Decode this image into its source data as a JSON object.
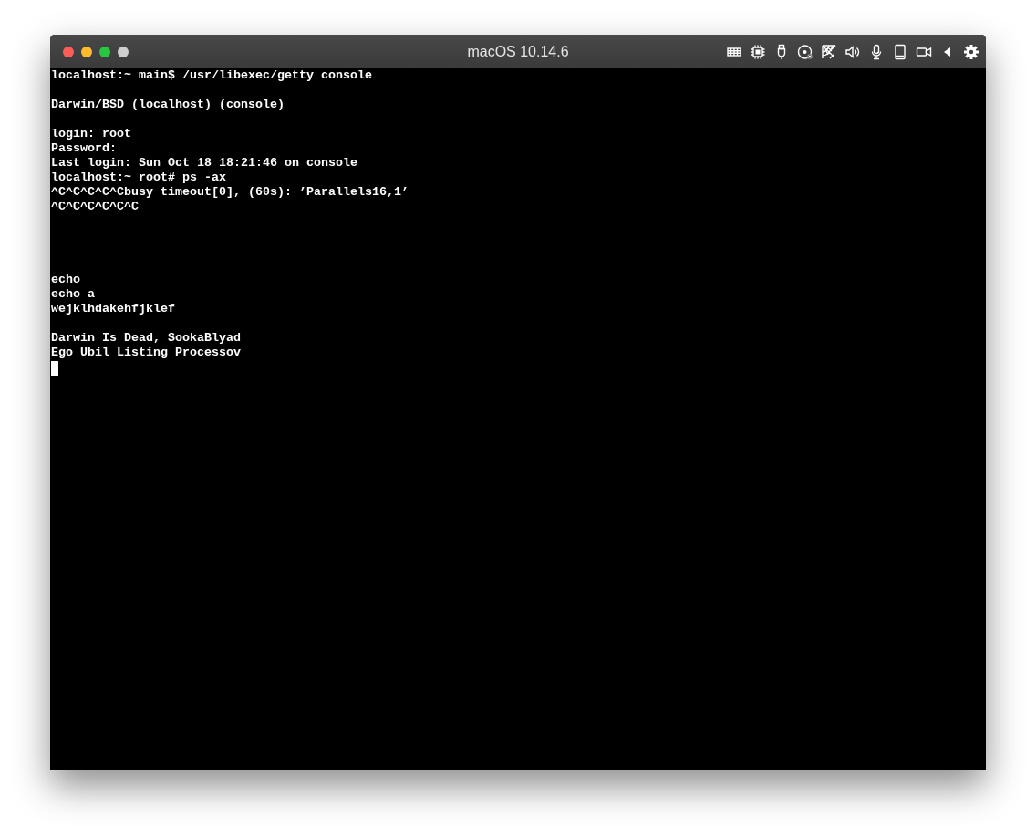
{
  "window": {
    "title": "macOS 10.14.6"
  },
  "terminal": {
    "lines": [
      {
        "kind": "text",
        "text": "localhost:~ main$ /usr/libexec/getty console"
      },
      {
        "kind": "blank"
      },
      {
        "kind": "text",
        "text": "Darwin/BSD (localhost) (console)"
      },
      {
        "kind": "blank"
      },
      {
        "kind": "text",
        "text": "login: root"
      },
      {
        "kind": "text",
        "text": "Password:"
      },
      {
        "kind": "text",
        "text": "Last login: Sun Oct 18 18:21:46 on console"
      },
      {
        "kind": "text",
        "text": "localhost:~ root# ps -ax"
      },
      {
        "kind": "text",
        "text": "^C^C^C^C^Cbusy timeout[0], (60s): ’Parallels16,1’"
      },
      {
        "kind": "text",
        "text": "^C^C^C^C^C^C"
      },
      {
        "kind": "blank"
      },
      {
        "kind": "blank"
      },
      {
        "kind": "blank"
      },
      {
        "kind": "blank"
      },
      {
        "kind": "text",
        "text": "echo"
      },
      {
        "kind": "text",
        "text": "echo a"
      },
      {
        "kind": "text",
        "text": "wejklhdakehfjklef"
      },
      {
        "kind": "blank"
      },
      {
        "kind": "text",
        "text": "Darwin Is Dead, SookaBlyad"
      },
      {
        "kind": "text",
        "text": "Ego Ubil Listing Processov"
      },
      {
        "kind": "cursor"
      }
    ]
  }
}
